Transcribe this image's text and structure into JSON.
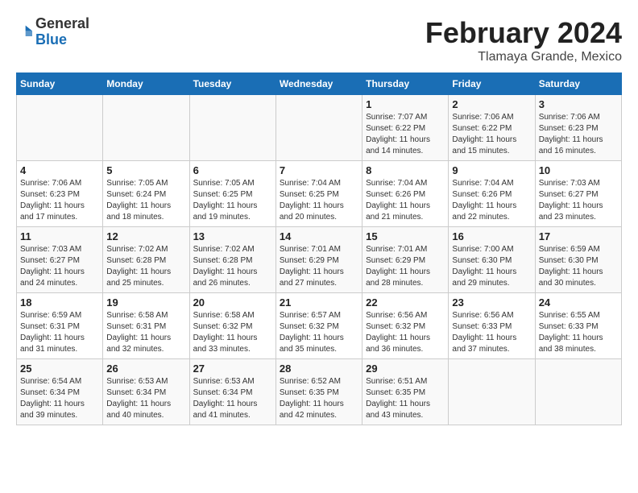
{
  "logo": {
    "line1": "General",
    "line2": "Blue"
  },
  "title": "February 2024",
  "subtitle": "Tlamaya Grande, Mexico",
  "weekdays": [
    "Sunday",
    "Monday",
    "Tuesday",
    "Wednesday",
    "Thursday",
    "Friday",
    "Saturday"
  ],
  "weeks": [
    [
      {
        "day": "",
        "sunrise": "",
        "sunset": "",
        "daylight": ""
      },
      {
        "day": "",
        "sunrise": "",
        "sunset": "",
        "daylight": ""
      },
      {
        "day": "",
        "sunrise": "",
        "sunset": "",
        "daylight": ""
      },
      {
        "day": "",
        "sunrise": "",
        "sunset": "",
        "daylight": ""
      },
      {
        "day": "1",
        "sunrise": "Sunrise: 7:07 AM",
        "sunset": "Sunset: 6:22 PM",
        "daylight": "Daylight: 11 hours and 14 minutes."
      },
      {
        "day": "2",
        "sunrise": "Sunrise: 7:06 AM",
        "sunset": "Sunset: 6:22 PM",
        "daylight": "Daylight: 11 hours and 15 minutes."
      },
      {
        "day": "3",
        "sunrise": "Sunrise: 7:06 AM",
        "sunset": "Sunset: 6:23 PM",
        "daylight": "Daylight: 11 hours and 16 minutes."
      }
    ],
    [
      {
        "day": "4",
        "sunrise": "Sunrise: 7:06 AM",
        "sunset": "Sunset: 6:23 PM",
        "daylight": "Daylight: 11 hours and 17 minutes."
      },
      {
        "day": "5",
        "sunrise": "Sunrise: 7:05 AM",
        "sunset": "Sunset: 6:24 PM",
        "daylight": "Daylight: 11 hours and 18 minutes."
      },
      {
        "day": "6",
        "sunrise": "Sunrise: 7:05 AM",
        "sunset": "Sunset: 6:25 PM",
        "daylight": "Daylight: 11 hours and 19 minutes."
      },
      {
        "day": "7",
        "sunrise": "Sunrise: 7:04 AM",
        "sunset": "Sunset: 6:25 PM",
        "daylight": "Daylight: 11 hours and 20 minutes."
      },
      {
        "day": "8",
        "sunrise": "Sunrise: 7:04 AM",
        "sunset": "Sunset: 6:26 PM",
        "daylight": "Daylight: 11 hours and 21 minutes."
      },
      {
        "day": "9",
        "sunrise": "Sunrise: 7:04 AM",
        "sunset": "Sunset: 6:26 PM",
        "daylight": "Daylight: 11 hours and 22 minutes."
      },
      {
        "day": "10",
        "sunrise": "Sunrise: 7:03 AM",
        "sunset": "Sunset: 6:27 PM",
        "daylight": "Daylight: 11 hours and 23 minutes."
      }
    ],
    [
      {
        "day": "11",
        "sunrise": "Sunrise: 7:03 AM",
        "sunset": "Sunset: 6:27 PM",
        "daylight": "Daylight: 11 hours and 24 minutes."
      },
      {
        "day": "12",
        "sunrise": "Sunrise: 7:02 AM",
        "sunset": "Sunset: 6:28 PM",
        "daylight": "Daylight: 11 hours and 25 minutes."
      },
      {
        "day": "13",
        "sunrise": "Sunrise: 7:02 AM",
        "sunset": "Sunset: 6:28 PM",
        "daylight": "Daylight: 11 hours and 26 minutes."
      },
      {
        "day": "14",
        "sunrise": "Sunrise: 7:01 AM",
        "sunset": "Sunset: 6:29 PM",
        "daylight": "Daylight: 11 hours and 27 minutes."
      },
      {
        "day": "15",
        "sunrise": "Sunrise: 7:01 AM",
        "sunset": "Sunset: 6:29 PM",
        "daylight": "Daylight: 11 hours and 28 minutes."
      },
      {
        "day": "16",
        "sunrise": "Sunrise: 7:00 AM",
        "sunset": "Sunset: 6:30 PM",
        "daylight": "Daylight: 11 hours and 29 minutes."
      },
      {
        "day": "17",
        "sunrise": "Sunrise: 6:59 AM",
        "sunset": "Sunset: 6:30 PM",
        "daylight": "Daylight: 11 hours and 30 minutes."
      }
    ],
    [
      {
        "day": "18",
        "sunrise": "Sunrise: 6:59 AM",
        "sunset": "Sunset: 6:31 PM",
        "daylight": "Daylight: 11 hours and 31 minutes."
      },
      {
        "day": "19",
        "sunrise": "Sunrise: 6:58 AM",
        "sunset": "Sunset: 6:31 PM",
        "daylight": "Daylight: 11 hours and 32 minutes."
      },
      {
        "day": "20",
        "sunrise": "Sunrise: 6:58 AM",
        "sunset": "Sunset: 6:32 PM",
        "daylight": "Daylight: 11 hours and 33 minutes."
      },
      {
        "day": "21",
        "sunrise": "Sunrise: 6:57 AM",
        "sunset": "Sunset: 6:32 PM",
        "daylight": "Daylight: 11 hours and 35 minutes."
      },
      {
        "day": "22",
        "sunrise": "Sunrise: 6:56 AM",
        "sunset": "Sunset: 6:32 PM",
        "daylight": "Daylight: 11 hours and 36 minutes."
      },
      {
        "day": "23",
        "sunrise": "Sunrise: 6:56 AM",
        "sunset": "Sunset: 6:33 PM",
        "daylight": "Daylight: 11 hours and 37 minutes."
      },
      {
        "day": "24",
        "sunrise": "Sunrise: 6:55 AM",
        "sunset": "Sunset: 6:33 PM",
        "daylight": "Daylight: 11 hours and 38 minutes."
      }
    ],
    [
      {
        "day": "25",
        "sunrise": "Sunrise: 6:54 AM",
        "sunset": "Sunset: 6:34 PM",
        "daylight": "Daylight: 11 hours and 39 minutes."
      },
      {
        "day": "26",
        "sunrise": "Sunrise: 6:53 AM",
        "sunset": "Sunset: 6:34 PM",
        "daylight": "Daylight: 11 hours and 40 minutes."
      },
      {
        "day": "27",
        "sunrise": "Sunrise: 6:53 AM",
        "sunset": "Sunset: 6:34 PM",
        "daylight": "Daylight: 11 hours and 41 minutes."
      },
      {
        "day": "28",
        "sunrise": "Sunrise: 6:52 AM",
        "sunset": "Sunset: 6:35 PM",
        "daylight": "Daylight: 11 hours and 42 minutes."
      },
      {
        "day": "29",
        "sunrise": "Sunrise: 6:51 AM",
        "sunset": "Sunset: 6:35 PM",
        "daylight": "Daylight: 11 hours and 43 minutes."
      },
      {
        "day": "",
        "sunrise": "",
        "sunset": "",
        "daylight": ""
      },
      {
        "day": "",
        "sunrise": "",
        "sunset": "",
        "daylight": ""
      }
    ]
  ]
}
